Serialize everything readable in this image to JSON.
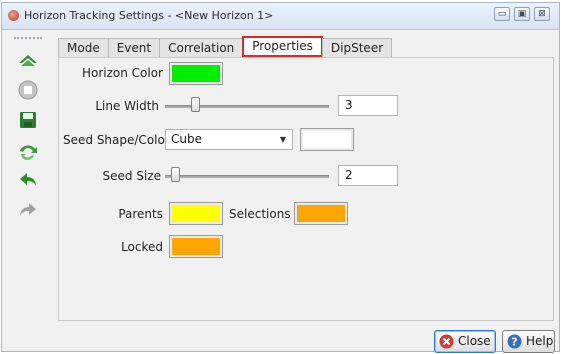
{
  "window": {
    "title": "Horizon Tracking Settings - <New Horizon 1>",
    "controls": {
      "minimize": "▭",
      "maximize": "▣",
      "close": "⊠"
    }
  },
  "toolbar": {
    "items": [
      {
        "name": "horizon-icon",
        "color": "#2e8b2e"
      },
      {
        "name": "stop-icon",
        "color": "#b5b5b5"
      },
      {
        "name": "save-icon",
        "color": "#2e7d32"
      },
      {
        "name": "retrack-icon",
        "color": "#3b9a3b"
      },
      {
        "name": "undo-icon",
        "color": "#2e8b2e"
      },
      {
        "name": "redo-icon",
        "color": "#a0a0a0"
      }
    ]
  },
  "tabs": [
    {
      "label": "Mode",
      "active": false
    },
    {
      "label": "Event",
      "active": false
    },
    {
      "label": "Correlation",
      "active": false
    },
    {
      "label": "Properties",
      "active": true
    },
    {
      "label": "DipSteer",
      "active": false
    }
  ],
  "properties": {
    "horizon_color_label": "Horizon Color",
    "horizon_color": "#00ee00",
    "line_width_label": "Line Width",
    "line_width_value": "3",
    "line_width_fraction": 0.18,
    "seed_shape_label": "Seed Shape/Color",
    "seed_shape_value": "Cube",
    "seed_color": "#ffffff",
    "seed_size_label": "Seed Size",
    "seed_size_value": "2",
    "seed_size_fraction": 0.06,
    "parents_label": "Parents",
    "parents_color": "#ffff00",
    "selections_label": "Selections",
    "selections_color": "#ffa500",
    "locked_label": "Locked",
    "locked_color": "#ffa500"
  },
  "footer": {
    "close_label": "Close",
    "help_label": "Help"
  },
  "colors": {
    "active_tab_border": "#e0262d",
    "close_icon": "#d23b30",
    "help_icon": "#2f6fc4"
  }
}
